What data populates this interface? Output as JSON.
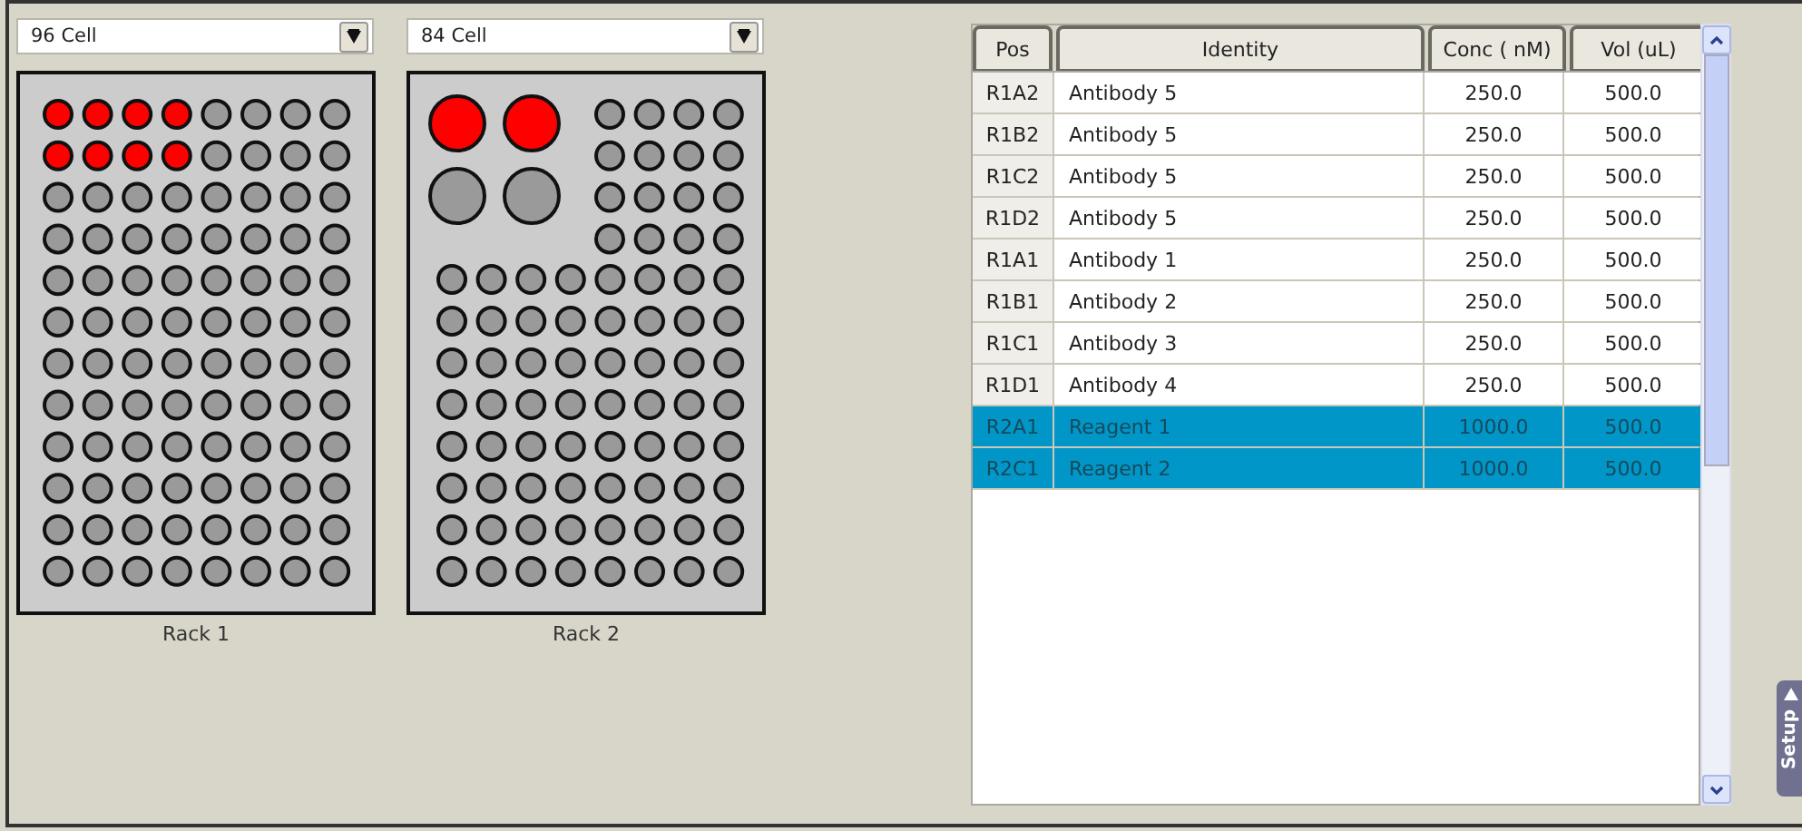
{
  "racks": [
    {
      "type": "96 Cell",
      "label": "Rack 1",
      "kind": "grid96",
      "wells": [
        [
          true,
          true,
          true,
          true,
          false,
          false,
          false,
          false
        ],
        [
          true,
          true,
          true,
          true,
          false,
          false,
          false,
          false
        ],
        [
          false,
          false,
          false,
          false,
          false,
          false,
          false,
          false
        ],
        [
          false,
          false,
          false,
          false,
          false,
          false,
          false,
          false
        ],
        [
          false,
          false,
          false,
          false,
          false,
          false,
          false,
          false
        ],
        [
          false,
          false,
          false,
          false,
          false,
          false,
          false,
          false
        ],
        [
          false,
          false,
          false,
          false,
          false,
          false,
          false,
          false
        ],
        [
          false,
          false,
          false,
          false,
          false,
          false,
          false,
          false
        ],
        [
          false,
          false,
          false,
          false,
          false,
          false,
          false,
          false
        ],
        [
          false,
          false,
          false,
          false,
          false,
          false,
          false,
          false
        ],
        [
          false,
          false,
          false,
          false,
          false,
          false,
          false,
          false
        ],
        [
          false,
          false,
          false,
          false,
          false,
          false,
          false,
          false
        ]
      ]
    },
    {
      "type": "84 Cell",
      "label": "Rack 2",
      "kind": "grid84",
      "large_wells": [
        [
          true,
          true
        ],
        [
          false,
          false
        ]
      ],
      "top_wells": [
        [
          false,
          false,
          false,
          false
        ],
        [
          false,
          false,
          false,
          false
        ],
        [
          false,
          false,
          false,
          false
        ],
        [
          false,
          false,
          false,
          false
        ]
      ],
      "wells": [
        [
          false,
          false,
          false,
          false,
          false,
          false,
          false,
          false
        ],
        [
          false,
          false,
          false,
          false,
          false,
          false,
          false,
          false
        ],
        [
          false,
          false,
          false,
          false,
          false,
          false,
          false,
          false
        ],
        [
          false,
          false,
          false,
          false,
          false,
          false,
          false,
          false
        ],
        [
          false,
          false,
          false,
          false,
          false,
          false,
          false,
          false
        ],
        [
          false,
          false,
          false,
          false,
          false,
          false,
          false,
          false
        ],
        [
          false,
          false,
          false,
          false,
          false,
          false,
          false,
          false
        ],
        [
          false,
          false,
          false,
          false,
          false,
          false,
          false,
          false
        ]
      ]
    }
  ],
  "table": {
    "columns": [
      "Pos",
      "Identity",
      "Conc ( nM)",
      "Vol (uL)"
    ],
    "rows": [
      {
        "pos": "R1A2",
        "identity": "Antibody 5",
        "conc": "250.0",
        "vol": "500.0",
        "selected": false
      },
      {
        "pos": "R1B2",
        "identity": "Antibody 5",
        "conc": "250.0",
        "vol": "500.0",
        "selected": false
      },
      {
        "pos": "R1C2",
        "identity": "Antibody 5",
        "conc": "250.0",
        "vol": "500.0",
        "selected": false
      },
      {
        "pos": "R1D2",
        "identity": "Antibody 5",
        "conc": "250.0",
        "vol": "500.0",
        "selected": false
      },
      {
        "pos": "R1A1",
        "identity": "Antibody 1",
        "conc": "250.0",
        "vol": "500.0",
        "selected": false
      },
      {
        "pos": "R1B1",
        "identity": "Antibody 2",
        "conc": "250.0",
        "vol": "500.0",
        "selected": false
      },
      {
        "pos": "R1C1",
        "identity": "Antibody 3",
        "conc": "250.0",
        "vol": "500.0",
        "selected": false
      },
      {
        "pos": "R1D1",
        "identity": "Antibody 4",
        "conc": "250.0",
        "vol": "500.0",
        "selected": false
      },
      {
        "pos": "R2A1",
        "identity": "Reagent 1",
        "conc": "1000.0",
        "vol": "500.0",
        "selected": true
      },
      {
        "pos": "R2C1",
        "identity": "Reagent 2",
        "conc": "1000.0",
        "vol": "500.0",
        "selected": true
      }
    ]
  },
  "side_tab": {
    "label": "Setup"
  }
}
